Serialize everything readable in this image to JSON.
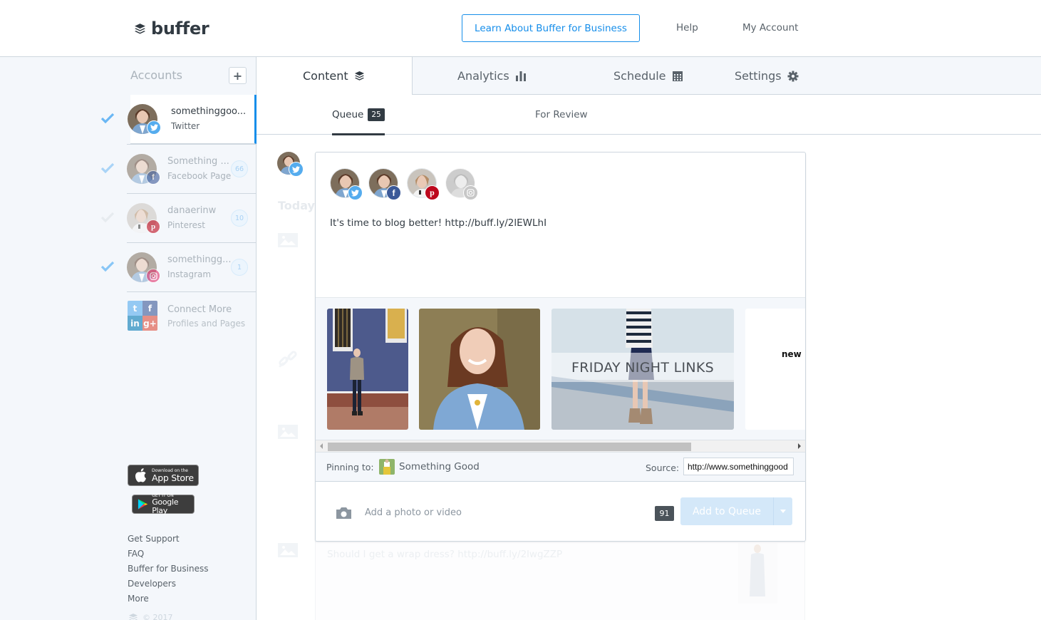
{
  "header": {
    "logo_text": "buffer",
    "business_button": "Learn About Buffer for Business",
    "nav": [
      "Help",
      "My Account"
    ]
  },
  "sidebar": {
    "accounts_title": "Accounts",
    "add_account_symbol": "+",
    "accounts": [
      {
        "name": "somethinggoo...",
        "type": "Twitter",
        "network": "twitter",
        "selected": true,
        "active": true,
        "count": null
      },
      {
        "name": "Something ...",
        "type": "Facebook Page",
        "network": "facebook",
        "selected": true,
        "active": false,
        "count": "66"
      },
      {
        "name": "danaerinw",
        "type": "Pinterest",
        "network": "pinterest",
        "selected": false,
        "active": false,
        "count": "10"
      },
      {
        "name": "somethingg...",
        "type": "Instagram",
        "network": "instagram",
        "selected": true,
        "active": false,
        "count": "1"
      }
    ],
    "connect_more": {
      "title": "Connect More",
      "subtitle": "Profiles and Pages"
    },
    "app_store": {
      "small": "Download on the",
      "big": "App Store"
    },
    "google_play": {
      "small": "GET IT ON",
      "big": "Google Play"
    },
    "footer_links": [
      "Get Support",
      "FAQ",
      "Buffer for Business",
      "Developers",
      "More"
    ],
    "copyright": "© 2017"
  },
  "main_tabs": [
    {
      "label": "Content",
      "icon": "layers-icon",
      "active": true
    },
    {
      "label": "Analytics",
      "icon": "bar-chart-icon",
      "active": false
    },
    {
      "label": "Schedule",
      "icon": "calendar-icon",
      "active": false
    },
    {
      "label": "Settings",
      "icon": "gear-icon",
      "active": false
    }
  ],
  "sub_tabs": [
    {
      "label": "Queue",
      "count": "25",
      "active": true
    },
    {
      "label": "For Review",
      "count": null,
      "active": false
    }
  ],
  "queue": {
    "day_label": "Today",
    "background_post": "Should I get a wrap dress? http://buff.ly/2lwgZZP"
  },
  "composer": {
    "profiles": [
      {
        "network": "twitter",
        "enabled": true
      },
      {
        "network": "facebook",
        "enabled": true
      },
      {
        "network": "pinterest",
        "enabled": true
      },
      {
        "network": "instagram",
        "enabled": false
      }
    ],
    "text": "It's time to blog better! http://buff.ly/2lEWLhI",
    "media": [
      {
        "kind": "photo",
        "description": "woman standing by blue brick wall"
      },
      {
        "kind": "photo",
        "description": "smiling woman in denim shirt"
      },
      {
        "kind": "photo",
        "caption": "FRIDAY NIGHT LINKS"
      },
      {
        "kind": "graphic",
        "caption": "new b"
      }
    ],
    "pinning_label": "Pinning to:",
    "pin_board": "Something Good",
    "source_label": "Source:",
    "source_value": "http://www.somethinggood",
    "add_media_label": "Add a photo or video",
    "char_count": "91",
    "submit_label": "Add to Queue"
  },
  "colors": {
    "brand_blue": "#168eea",
    "twitter": "#55acee",
    "facebook": "#3b5998",
    "pinterest": "#bd081c",
    "instagram": "#c7c7c7",
    "dark_text": "#323b43",
    "sidebar_bg": "#f4f7fb"
  }
}
